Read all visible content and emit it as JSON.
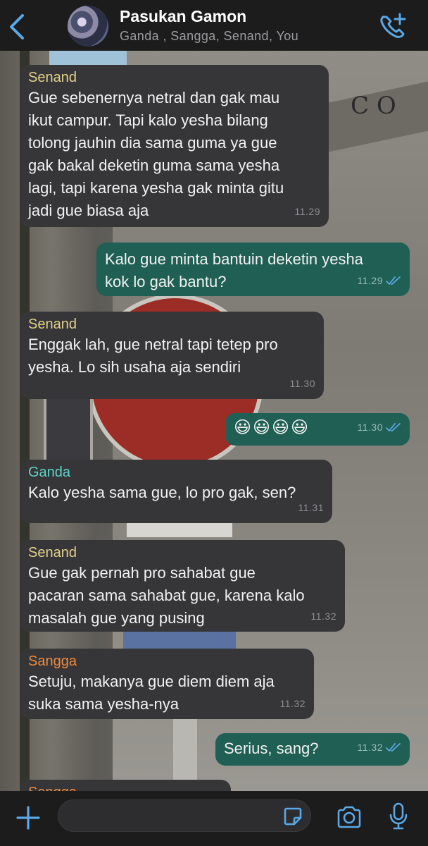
{
  "header": {
    "title": "Pasukan Gamon",
    "subtitle": "Ganda , Sangga, Senand, You"
  },
  "colors": {
    "accent": "#5aa9e6",
    "incoming_bubble": "#363638",
    "outgoing_bubble": "#1f5f54",
    "sender_senand": "#e3d28a",
    "sender_ganda": "#5fd3c9",
    "sender_sangga": "#f08a3b"
  },
  "messages": [
    {
      "direction": "in",
      "sender": "Senand",
      "text": "Gue sebenernya netral dan gak mau\nikut campur. Tapi kalo yesha bilang\ntolong jauhin dia sama guma ya gue\ngak bakal deketin guma sama yesha\nlagi, tapi karena yesha gak minta gitu\njadi gue biasa aja",
      "time": "11.29"
    },
    {
      "direction": "out",
      "text": "Kalo gue minta bantuin deketin yesha\nkok lo gak bantu?",
      "time": "11.29"
    },
    {
      "direction": "in",
      "sender": "Senand",
      "text": "Enggak lah, gue netral tapi tetep pro\nyesha. Lo sih usaha aja sendiri",
      "time": "11.30"
    },
    {
      "direction": "out",
      "text": "😃😃😃😃",
      "time": "11.30"
    },
    {
      "direction": "in",
      "sender": "Ganda",
      "text": "Kalo yesha sama gue, lo pro gak, sen?",
      "time": "11.31"
    },
    {
      "direction": "in",
      "sender": "Senand",
      "text": "Gue gak pernah pro sahabat gue\npacaran sama sahabat gue, karena kalo\nmasalah gue yang pusing",
      "time": "11.32"
    },
    {
      "direction": "in",
      "sender": "Sangga",
      "text": "Setuju, makanya gue diem diem aja\nsuka sama yesha-nya",
      "time": "11.32"
    },
    {
      "direction": "out",
      "text": "Serius, sang?",
      "time": "11.32"
    },
    {
      "direction": "in",
      "sender": "Sangga",
      "text": "",
      "time": ""
    }
  ],
  "composer": {
    "value": "",
    "placeholder": ""
  },
  "wallpaper": {
    "letter": "C O"
  },
  "icons": {
    "back": "chevron-left-icon",
    "call": "add-call-icon",
    "plus": "plus-icon",
    "sticker": "sticker-icon",
    "camera": "camera-icon",
    "mic": "microphone-icon"
  }
}
